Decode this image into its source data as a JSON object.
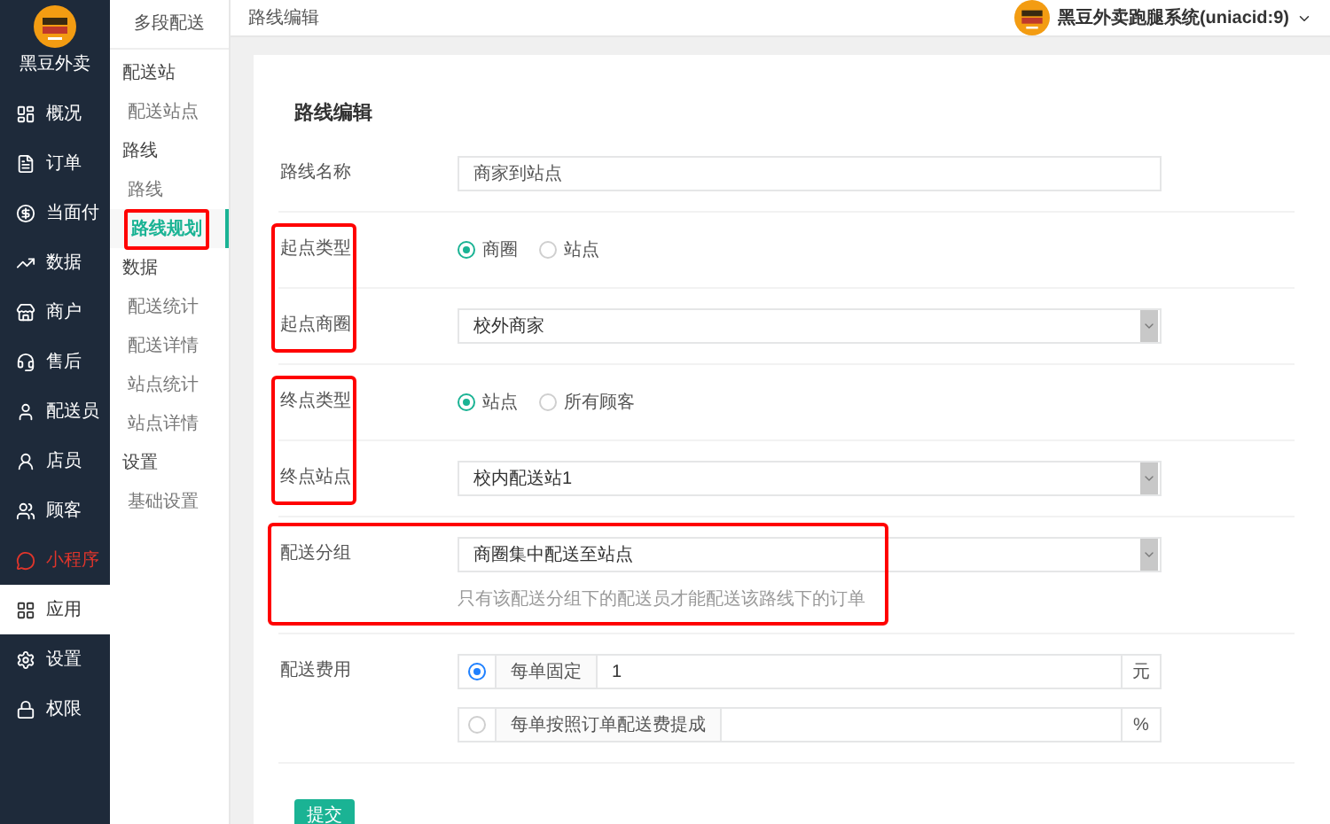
{
  "brand": {
    "name": "黑豆外卖"
  },
  "sidebar": {
    "items": [
      {
        "label": "概况",
        "selected": false,
        "alert": false
      },
      {
        "label": "订单",
        "selected": false,
        "alert": false
      },
      {
        "label": "当面付",
        "selected": false,
        "alert": false
      },
      {
        "label": "数据",
        "selected": false,
        "alert": false
      },
      {
        "label": "商户",
        "selected": false,
        "alert": false
      },
      {
        "label": "售后",
        "selected": false,
        "alert": false
      },
      {
        "label": "配送员",
        "selected": false,
        "alert": false
      },
      {
        "label": "店员",
        "selected": false,
        "alert": false
      },
      {
        "label": "顾客",
        "selected": false,
        "alert": false
      },
      {
        "label": "小程序",
        "selected": false,
        "alert": true
      },
      {
        "label": "应用",
        "selected": true,
        "alert": false
      },
      {
        "label": "设置",
        "selected": false,
        "alert": false
      },
      {
        "label": "权限",
        "selected": false,
        "alert": false
      }
    ]
  },
  "subnav": {
    "title": "多段配送",
    "groups": [
      {
        "label": "配送站",
        "items": [
          {
            "label": "配送站点",
            "selected": false,
            "annotated": false
          }
        ]
      },
      {
        "label": "路线",
        "items": [
          {
            "label": "路线",
            "selected": false,
            "annotated": false
          },
          {
            "label": "路线规划",
            "selected": true,
            "annotated": true
          }
        ]
      },
      {
        "label": "数据",
        "items": [
          {
            "label": "配送统计",
            "selected": false,
            "annotated": false
          },
          {
            "label": "配送详情",
            "selected": false,
            "annotated": false
          },
          {
            "label": "站点统计",
            "selected": false,
            "annotated": false
          },
          {
            "label": "站点详情",
            "selected": false,
            "annotated": false
          }
        ]
      },
      {
        "label": "设置",
        "items": [
          {
            "label": "基础设置",
            "selected": false,
            "annotated": false
          }
        ]
      }
    ]
  },
  "header": {
    "title": "路线编辑",
    "account": "黑豆外卖跑腿系统(uniacid:9)"
  },
  "form": {
    "title": "路线编辑",
    "sections": [
      {
        "annotated": false,
        "fields": [
          {
            "kind": "text",
            "label": "路线名称",
            "value": "商家到站点"
          }
        ]
      },
      {
        "annotated": true,
        "fields": [
          {
            "kind": "radio",
            "label": "起点类型",
            "options": [
              {
                "label": "商圈",
                "selected": true
              },
              {
                "label": "站点",
                "selected": false
              }
            ]
          },
          {
            "kind": "select",
            "label": "起点商圈",
            "value": "校外商家"
          }
        ]
      },
      {
        "annotated": true,
        "fields": [
          {
            "kind": "radio",
            "label": "终点类型",
            "options": [
              {
                "label": "站点",
                "selected": true
              },
              {
                "label": "所有顾客",
                "selected": false
              }
            ]
          },
          {
            "kind": "select",
            "label": "终点站点",
            "value": "校内配送站1"
          }
        ]
      },
      {
        "annotated": true,
        "fields": [
          {
            "kind": "select",
            "label": "配送分组",
            "value": "商圈集中配送至站点",
            "hint": "只有该配送分组下的配送员才能配送该路线下的订单"
          }
        ]
      },
      {
        "annotated": false,
        "fields": [
          {
            "kind": "fee",
            "label": "配送费用",
            "options": [
              {
                "label": "每单固定",
                "value": "1",
                "unit": "元",
                "selected": true
              },
              {
                "label": "每单按照订单配送费提成",
                "unit": "%",
                "selected": false
              }
            ]
          }
        ]
      }
    ],
    "submit": "提交"
  }
}
